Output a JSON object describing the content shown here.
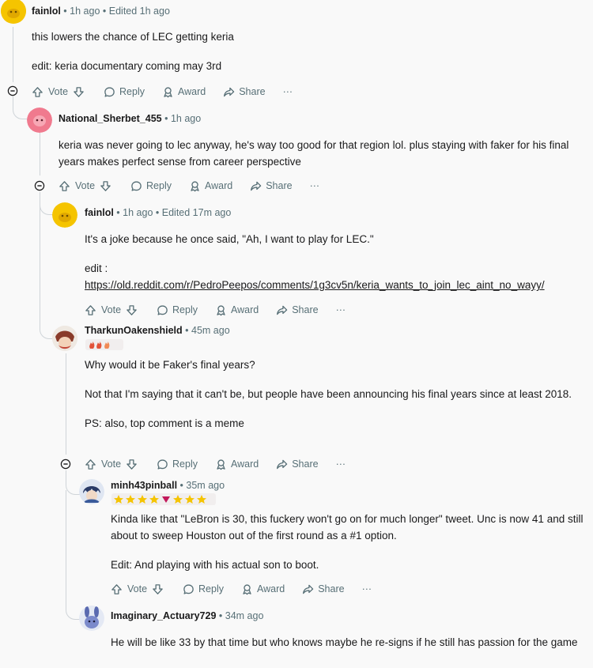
{
  "comments": [
    {
      "username": "fainlol",
      "time": "1h ago",
      "edited": "Edited 1h ago",
      "paragraphs": [
        "this lowers the chance of LEC getting keria",
        "edit: keria documentary coming may 3rd"
      ]
    },
    {
      "username": "National_Sherbet_455",
      "time": "1h ago",
      "paragraphs": [
        "keria was never going to lec anyway, he's way too good for that region lol. plus staying with faker for his final years makes perfect sense from career perspective"
      ]
    },
    {
      "username": "fainlol",
      "time": "1h ago",
      "edited": "Edited 17m ago",
      "paragraphs": [
        "It's a joke because he once said, \"Ah, I want to play for LEC.\"",
        "edit :"
      ],
      "link": "https://old.reddit.com/r/PedroPeepos/comments/1g3cv5n/keria_wants_to_join_lec_aint_no_wayy/"
    },
    {
      "username": "TharkunOakenshield",
      "time": "45m ago",
      "paragraphs": [
        "Why would it be Faker's final years?",
        "Not that I'm saying that it can't be, but people have been announcing his final years since at least 2018.",
        "PS: also, top comment is a meme"
      ]
    },
    {
      "username": "minh43pinball",
      "time": "35m ago",
      "paragraphs": [
        "Kinda like that \"LeBron is 30, this fuckery won't go on for much longer\" tweet. Unc is now 41 and still about to sweep Houston out of the first round as a #1 option.",
        "Edit: And playing with his actual son to boot."
      ]
    },
    {
      "username": "Imaginary_Actuary729",
      "time": "34m ago",
      "paragraphs": [
        "He will be like 33 by that time but who knows maybe he re-signs if he still has passion for the game"
      ]
    }
  ],
  "actions": {
    "vote": "Vote",
    "reply": "Reply",
    "award": "Award",
    "share": "Share",
    "more": "···"
  },
  "separator": "•",
  "colors": {
    "text": "#1a1a1b",
    "meta": "#576f76",
    "thread_line": "#cfd4d8",
    "avatar_yellow": "#f5c400",
    "avatar_pink": "#f07a8e"
  }
}
